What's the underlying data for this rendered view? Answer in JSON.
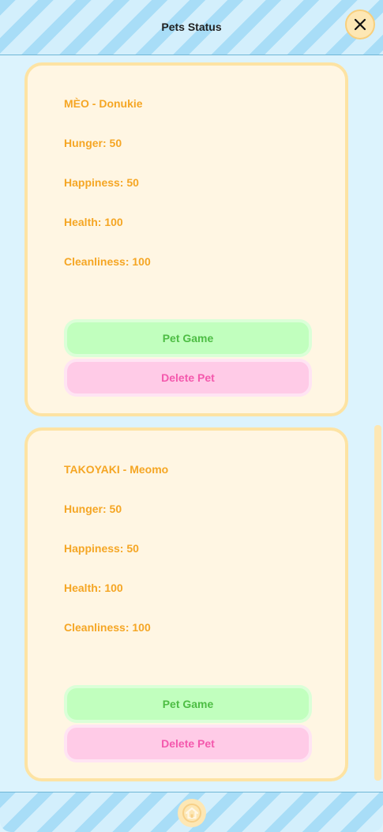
{
  "header": {
    "title": "Pets Status",
    "close_icon": "close-icon"
  },
  "pets": [
    {
      "title": "MÈO - Donukie",
      "hunger": "Hunger: 50",
      "happiness": "Happiness: 50",
      "health": "Health: 100",
      "cleanliness": "Cleanliness: 100",
      "pet_game_label": "Pet Game",
      "delete_label": "Delete Pet"
    },
    {
      "title": "TAKOYAKI - Meomo",
      "hunger": "Hunger: 50",
      "happiness": "Happiness: 50",
      "health": "Health: 100",
      "cleanliness": "Cleanliness: 100",
      "pet_game_label": "Pet Game",
      "delete_label": "Delete Pet"
    }
  ],
  "footer": {
    "home_icon": "home-icon"
  },
  "colors": {
    "stat_text": "#f5a624",
    "card_bg": "#fff6e3",
    "card_border": "#fde3a3",
    "pet_game_bg": "#c1ffbe",
    "pet_game_text": "#4dbd44",
    "delete_bg": "#ffcbe7",
    "delete_text": "#f459ad",
    "page_bg": "#dcf3fd",
    "stripe_blue": "#a8ddf7",
    "accent_yellow": "#fde7b4"
  }
}
